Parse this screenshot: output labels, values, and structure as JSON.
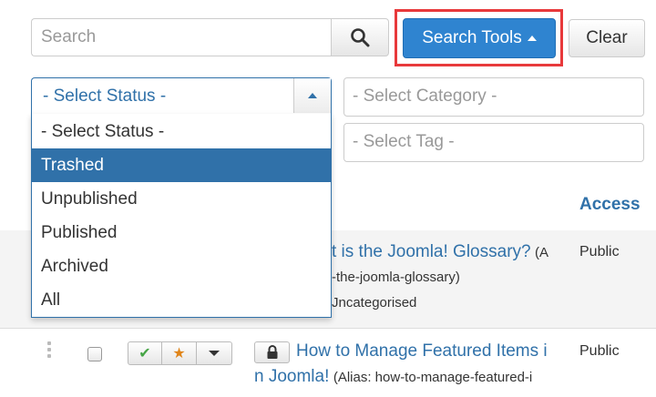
{
  "search": {
    "placeholder": "Search",
    "search_icon": "magnifier-icon"
  },
  "toolbar": {
    "search_tools_label": "Search Tools",
    "clear_label": "Clear"
  },
  "filters": {
    "status": {
      "selected": "- Select Status -",
      "options": [
        "- Select Status -",
        "Trashed",
        "Unpublished",
        "Published",
        "Archived",
        "All"
      ],
      "highlighted": "Trashed"
    },
    "category_placeholder": "- Select Category -",
    "tag_placeholder": "- Select Tag -"
  },
  "table": {
    "headers": {
      "access": "Access"
    },
    "rows": [
      {
        "title": "t is the Joomla! Glossary?",
        "alias": "(A",
        "alias_line2": "-the-joomla-glossary)",
        "category": "Jncategorised",
        "access": "Public"
      },
      {
        "title_line1": "How to Manage Featured Items i",
        "title_line2": "n Joomla!",
        "alias": "(Alias: how-to-manage-featured-i",
        "access": "Public"
      }
    ]
  },
  "colors": {
    "accent": "#2f84d0",
    "link": "#3071a9",
    "highlight_border": "#e8393b"
  }
}
